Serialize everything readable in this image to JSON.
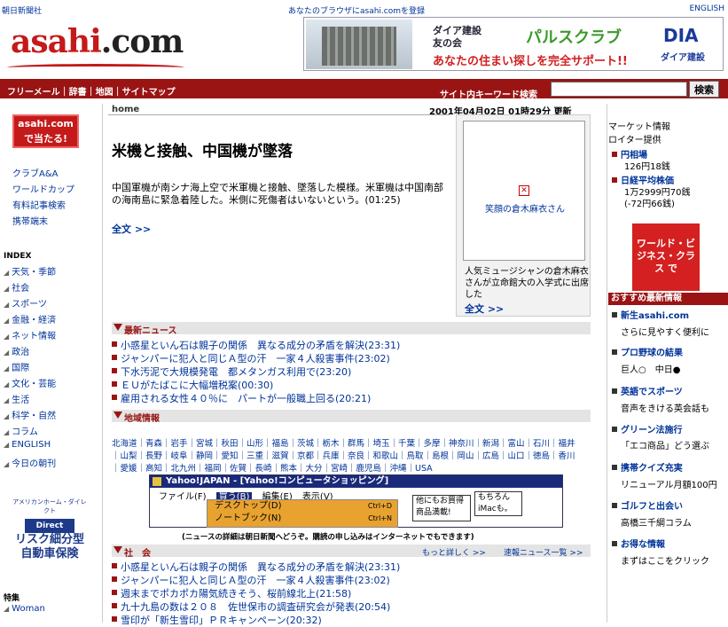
{
  "topbar": {
    "left": "朝日新聞社",
    "center": "あなたのブラウザにasahi.comを登録",
    "right": "ENGLISH"
  },
  "logo": {
    "text_a": "asahi",
    "text_b": ".com"
  },
  "banner": {
    "t1": "ダイア建設",
    "t2": "友の会",
    "t3": "パルスクラブ",
    "t4": "あなたの住まい探しを完全サポート!!",
    "brand": "DIA",
    "brand2": "ダイア建設"
  },
  "nav": {
    "links": "フリーメール｜辞書｜地図｜サイトマップ",
    "keyword_label": "サイト内キーワード検索",
    "search_value": "",
    "search_button": "検索"
  },
  "left": {
    "prize": "asahi.comで当たる!",
    "links": [
      "クラブA&A",
      "ワールドカップ",
      "有料記事検索",
      "携帯端末"
    ],
    "index_title": "INDEX",
    "index": [
      "天気・季節",
      "社会",
      "スポーツ",
      "金融・経済",
      "ネット情報",
      "政治",
      "国際",
      "文化・芸能",
      "生活",
      "科学・自然",
      "コラム",
      "ENGLISH",
      "今日の朝刊"
    ],
    "ad_top": "アメリカンホーム・ダイレクト",
    "ad_brand": "Direct",
    "ad_body": "リスク細分型自動車保険",
    "special_title": "特集",
    "special": [
      "Woman"
    ]
  },
  "main": {
    "home": "home",
    "date": "2001年04月02日 01時29分 更新",
    "headline": "米機と接触、中国機が墜落",
    "body": "中国軍機が南シナ海上空で米軍機と接触、墜落した模様。米軍機は中国南部の海南島に緊急着陸した。米側に死傷者はいないという。(01:25)",
    "more": "全文 >>",
    "photo_alt": "笑顔の倉木麻衣さん",
    "photo_text": "人気ミュージシャンの倉木麻衣さんが立命館大の入学式に出席した",
    "photo_more": "全文 >>",
    "latest_title": "最新ニュース",
    "latest": [
      "小惑星といん石は親子の関係　異なる成分の矛盾を解決(23:31)",
      "ジャンパーに犯人と同じＡ型の汗　一家４人殺害事件(23:02)",
      "下水汚泥で大規模発電　都メタンガス利用で(23:20)",
      "ＥＵがたばこに大幅増税案(00:30)",
      "雇用される女性４０％に　パートが一般職上回る(20:21)"
    ],
    "region_title": "地域情報",
    "region1": "北海道｜青森｜岩手｜宮城｜秋田｜山形｜福島｜茨城｜栃木｜群馬｜埼玉｜千葉｜多摩｜神奈川｜新潟｜富山｜石川｜福井",
    "region2": "｜山梨｜長野｜岐阜｜静岡｜愛知｜三重｜滋賀｜京都｜兵庫｜奈良｜和歌山｜鳥取｜島根｜岡山｜広島｜山口｜徳島｜香川",
    "region3": "｜愛媛｜高知｜北九州｜福岡｜佐賀｜長崎｜熊本｜大分｜宮崎｜鹿児島｜沖縄｜USA",
    "note": "(ニュースの詳細は朝日新聞へどうぞ。購読の申し込みはインターネットでもできます)",
    "social_title": "社　会",
    "social_more": "もっと詳しく >>",
    "social_list": "速報ニュース一覧 >>",
    "social": [
      "小惑星といん石は親子の関係　異なる成分の矛盾を解決(23:31)",
      "ジャンパーに犯人と同じＡ型の汗　一家４人殺害事件(23:02)",
      "週末までポカポカ陽気続きそう、桜前線北上(21:58)",
      "九十九島の数は２０８　佐世保市の調査研究会が発表(20:54)",
      "雪印が「新生雪印」ＰＲキャンペーン(20:32)"
    ]
  },
  "yahoo": {
    "title": "Yahoo!JAPAN - [Yahoo!コンピュータショッピング]",
    "menu": [
      "ファイル(F)",
      "買う(B)",
      "編集(E)",
      "表示(V)"
    ],
    "items": [
      {
        "label": "デスクトップ(D)",
        "key": "Ctrl+D"
      },
      {
        "label": "ノートブック(N)",
        "key": "Ctrl+N"
      }
    ],
    "tip1": "他にもお買得商品満載!",
    "tip2": "もちろんiMacも。"
  },
  "right": {
    "market": "マーケット情報",
    "reuters": "ロイター提供",
    "yen_label": "円相場",
    "yen_value": "126円18銭",
    "nikkei_label": "日経平均株価",
    "nikkei_value": "1万2999円70銭",
    "nikkei_change": "(-72円66銭)",
    "wbc": "ワールド・ビジネス・クラス で",
    "recommend": "おすすめ最新情報",
    "items": [
      {
        "title": "新生asahi.com",
        "desc": "さらに見やすく便利に"
      },
      {
        "title": "プロ野球の結果",
        "desc": "巨人○　中日●"
      },
      {
        "title": "英語でスポーツ",
        "desc": "音声をきける英会話も"
      },
      {
        "title": "グリーン法施行",
        "desc": "「エコ商品」どう選ぶ"
      },
      {
        "title": "携帯クイズ充実",
        "desc": "リニューアル月額100円"
      },
      {
        "title": "ゴルフと出会い",
        "desc": "高橋三千綱コラム"
      },
      {
        "title": "お得な情報",
        "desc": "まずはここをクリック"
      }
    ]
  },
  "colors": {
    "brand": "#9a1414",
    "link": "#003399"
  }
}
